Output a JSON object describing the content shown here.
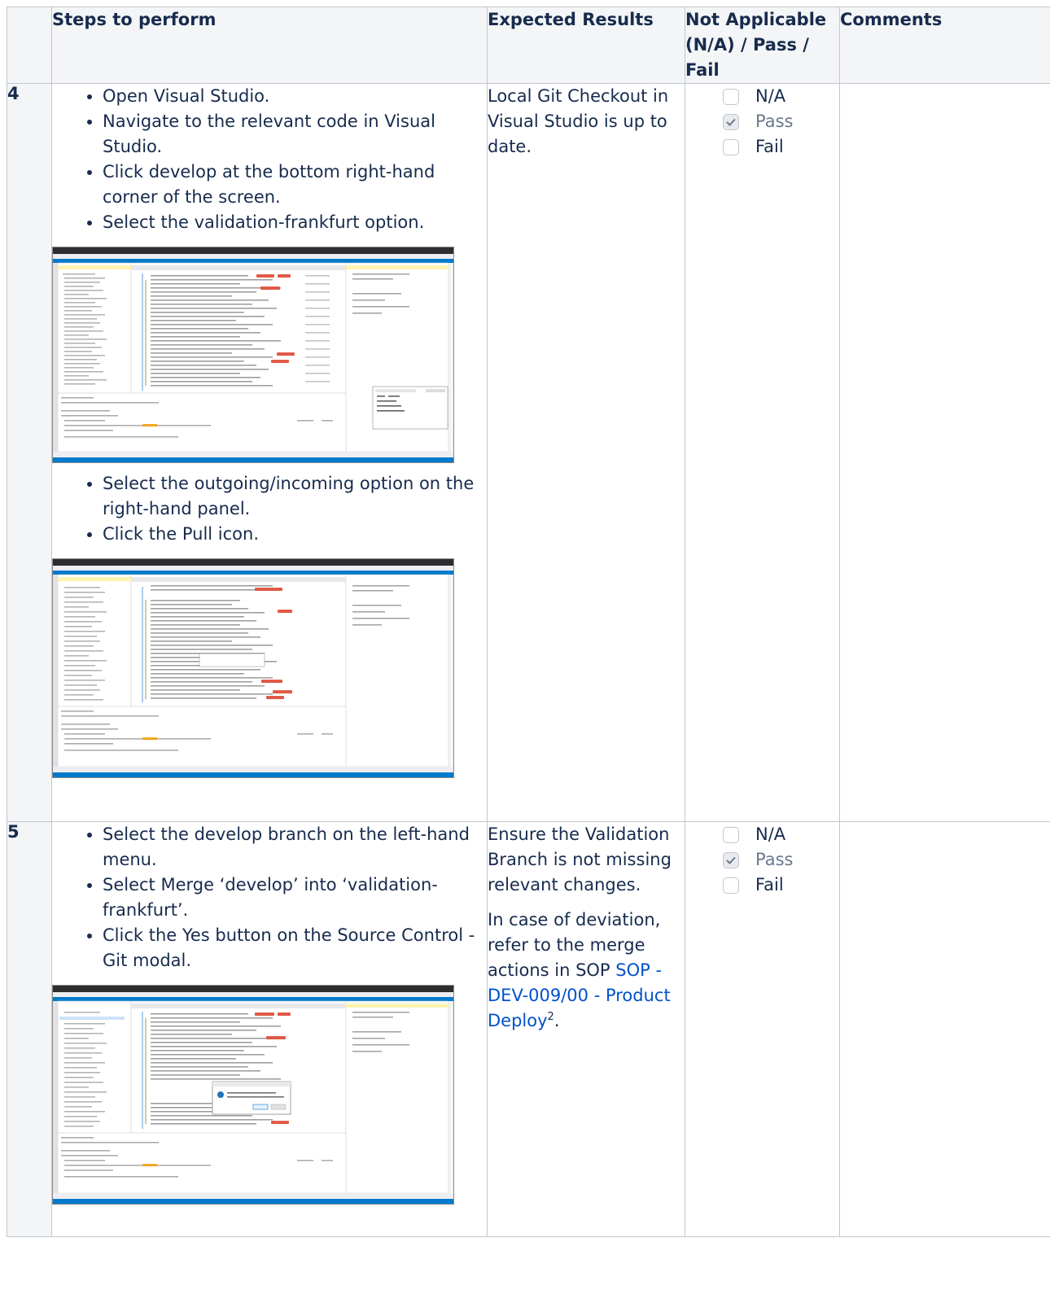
{
  "headers": {
    "steps": "Steps to perform",
    "expected": "Expected Results",
    "status": "Not Applicable (N/A) / Pass / Fail",
    "comments": "Comments"
  },
  "status_options": {
    "na": "N/A",
    "pass": "Pass",
    "fail": "Fail"
  },
  "rows": [
    {
      "number": "4",
      "steps_a": [
        "Open Visual Studio.",
        "Navigate to the relevant code in Visual Studio.",
        "Click develop at the bottom right-hand corner of the screen.",
        "Select the validation-frankfurt option."
      ],
      "steps_b": [
        "Select the outgoing/incoming option on the right-hand panel.",
        "Click the Pull icon."
      ],
      "expected": [
        "Local Git Checkout in Visual Studio is up to date."
      ],
      "status_checked": "pass",
      "comments": ""
    },
    {
      "number": "5",
      "steps_a": [
        "Select the develop branch on the left-hand menu.",
        "Select Merge ‘develop’ into ‘validation-frankfurt’.",
        "Click the Yes button on the Source Control - Git modal."
      ],
      "expected": [
        "Ensure the Validation Branch is not missing relevant changes."
      ],
      "expected_deviation_prefix": "In case of deviation, refer to the merge actions in SOP ",
      "expected_link": "SOP - DEV-009/00 - Product Deploy",
      "expected_link_sup": "2",
      "expected_suffix": ".",
      "status_checked": "pass",
      "comments": ""
    }
  ],
  "colors": {
    "header_bg": "#f4f5f7",
    "border": "#c1c7d0",
    "link": "#0052cc",
    "text": "#172b4d",
    "vs_blue": "#007acc"
  }
}
